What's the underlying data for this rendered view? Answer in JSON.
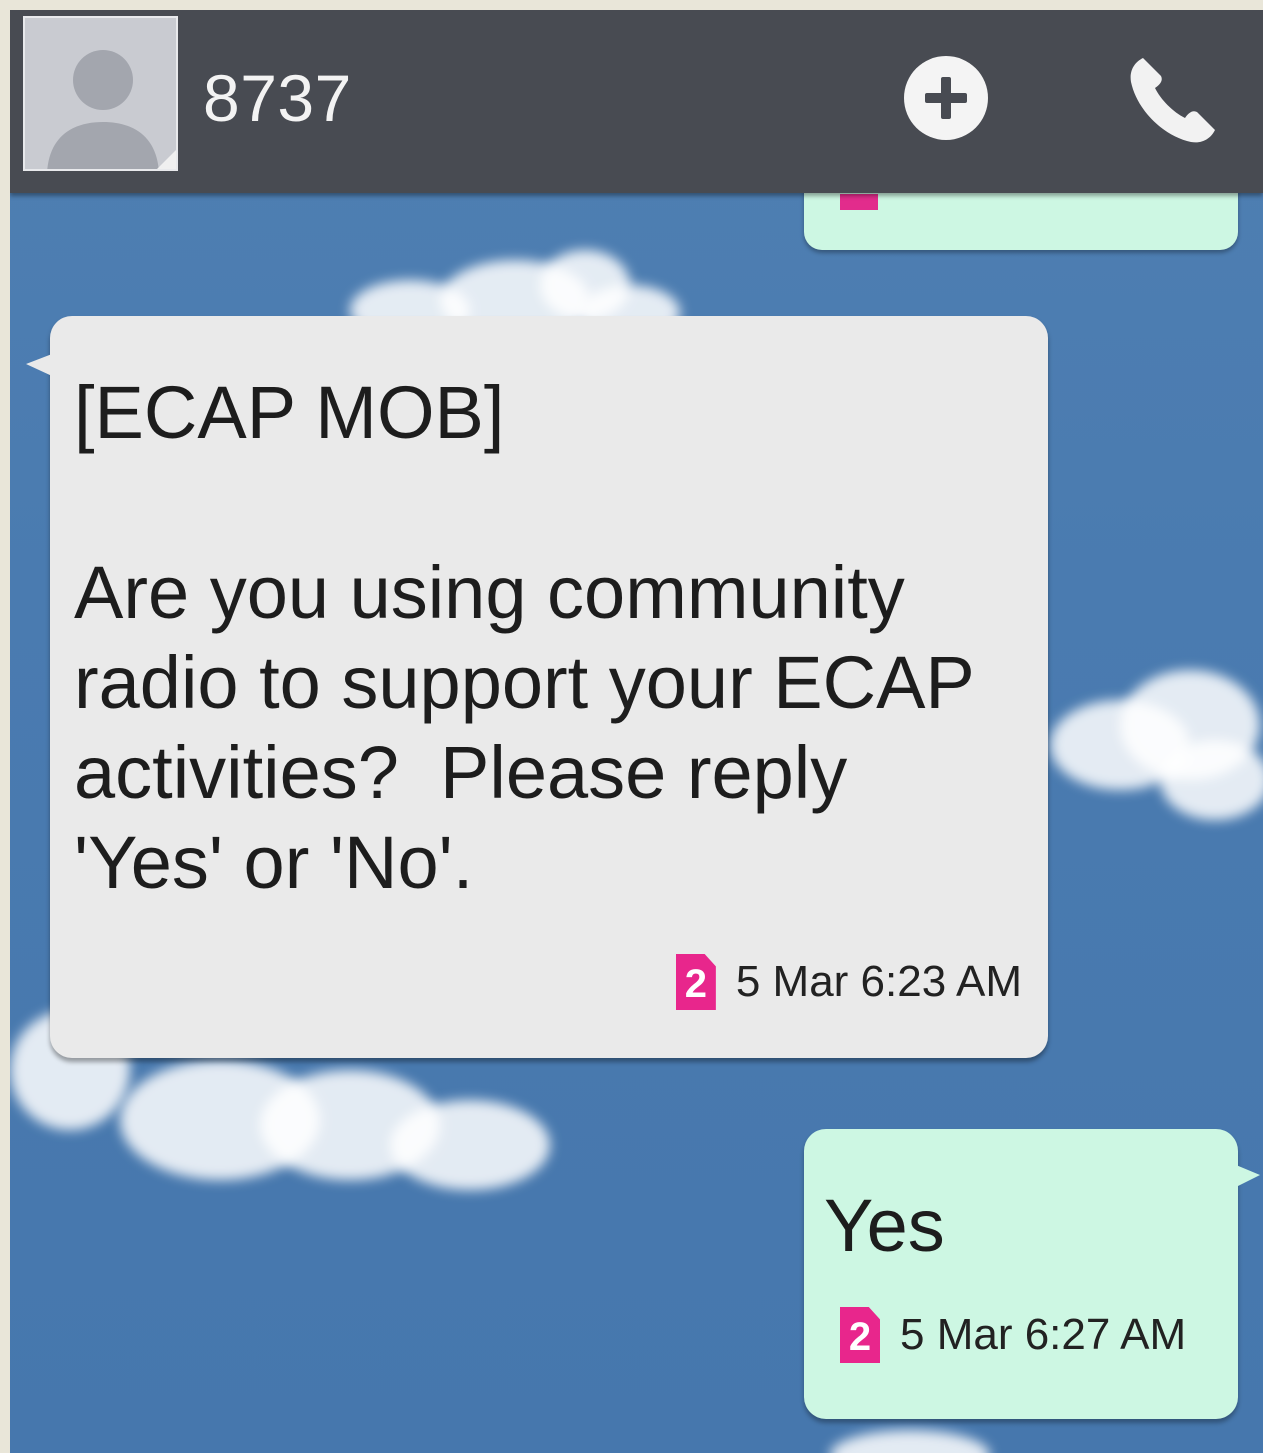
{
  "header": {
    "contact_name": "8737",
    "avatar_icon": "contact-placeholder-icon",
    "add_icon": "plus-circle-icon",
    "call_icon": "phone-icon"
  },
  "messages": [
    {
      "direction": "incoming",
      "text": "[ECAP MOB]\n\nAre you using community\nradio to support your ECAP\nactivities?  Please reply\n'Yes' or 'No'.",
      "sim": "2",
      "timestamp": "5 Mar 6:23 AM"
    },
    {
      "direction": "outgoing",
      "text": "Yes",
      "sim": "2",
      "timestamp": "5 Mar 6:27 AM"
    }
  ],
  "colors": {
    "header_bg": "#484b52",
    "incoming_bubble": "#eaeaea",
    "outgoing_bubble": "#cdf7e3",
    "sim_badge": "#e8268c",
    "sky_bg": "#4a7bb0"
  }
}
